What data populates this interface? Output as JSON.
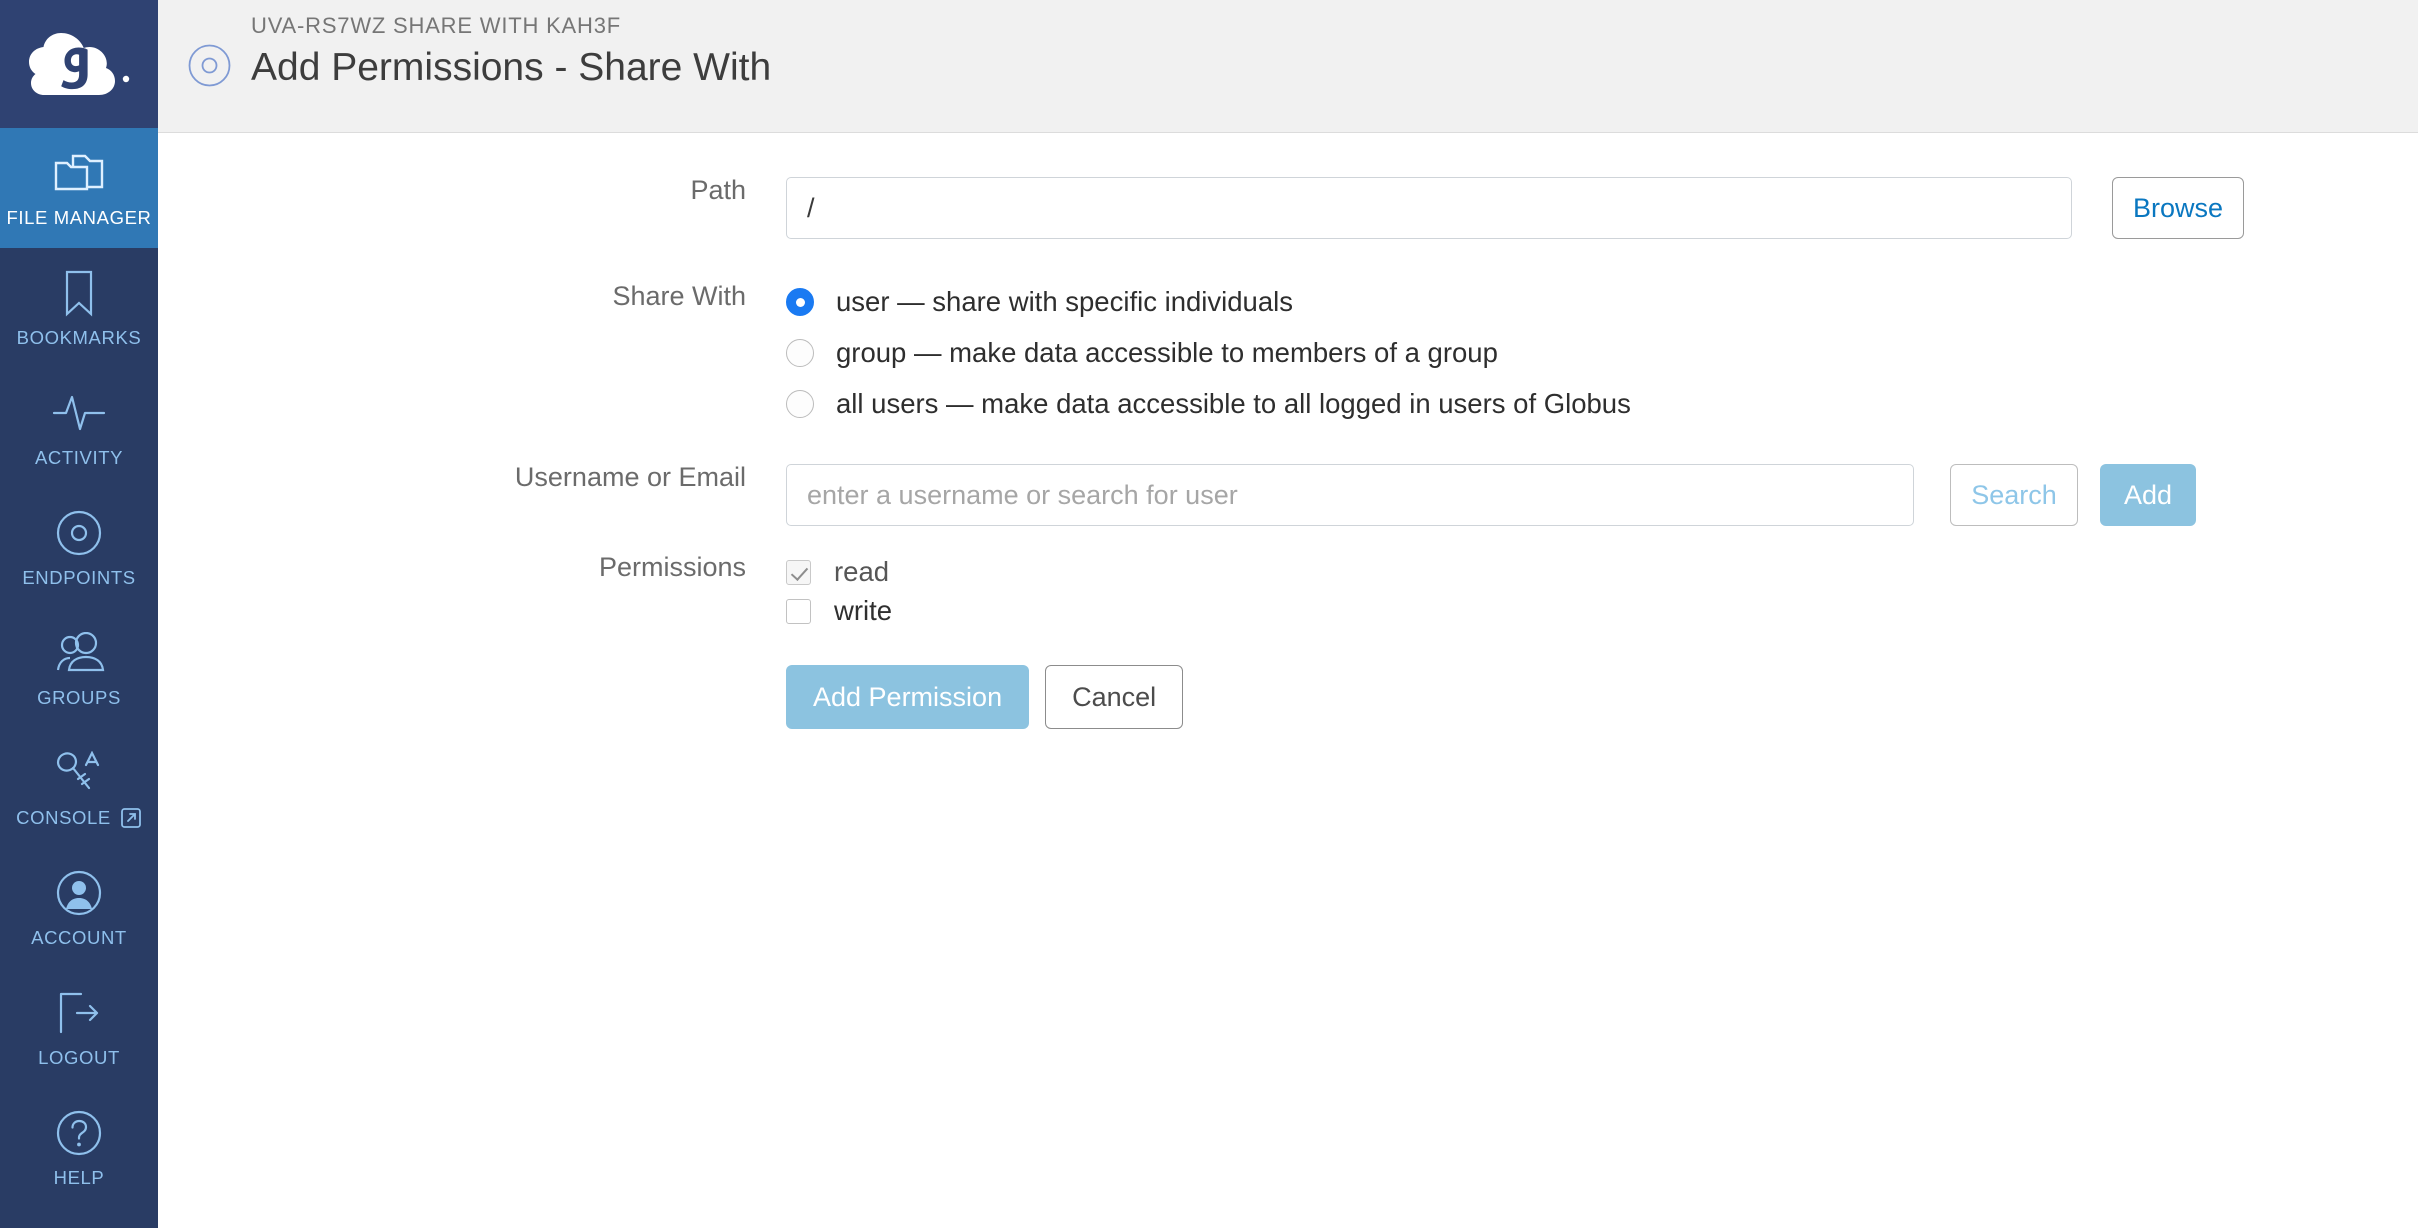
{
  "sidebar": {
    "logo_name": "globus-logo",
    "items": [
      {
        "label": "FILE MANAGER",
        "icon": "folders-icon",
        "active": true
      },
      {
        "label": "BOOKMARKS",
        "icon": "bookmark-icon",
        "active": false
      },
      {
        "label": "ACTIVITY",
        "icon": "activity-pulse-icon",
        "active": false
      },
      {
        "label": "ENDPOINTS",
        "icon": "endpoint-disc-icon",
        "active": false
      },
      {
        "label": "GROUPS",
        "icon": "groups-people-icon",
        "active": false
      },
      {
        "label": "CONSOLE",
        "icon": "key-a-icon",
        "active": false,
        "external": true
      },
      {
        "label": "ACCOUNT",
        "icon": "account-avatar-icon",
        "active": false
      },
      {
        "label": "LOGOUT",
        "icon": "logout-arrow-icon",
        "active": false
      },
      {
        "label": "HELP",
        "icon": "question-circle-icon",
        "active": false
      }
    ]
  },
  "header": {
    "icon": "endpoint-disc-icon",
    "breadcrumb": "UVA-RS7WZ SHARE WITH KAH3F",
    "title": "Add Permissions - Share With"
  },
  "form": {
    "path": {
      "label": "Path",
      "value": "/",
      "browse_label": "Browse"
    },
    "share_with": {
      "label": "Share With",
      "selected": "user",
      "options": [
        {
          "id": "user",
          "label": "user — share with specific individuals"
        },
        {
          "id": "group",
          "label": "group — make data accessible to members of a group"
        },
        {
          "id": "all-users",
          "label": "all users — make data accessible to all logged in users of Globus"
        }
      ]
    },
    "username": {
      "label": "Username or Email",
      "value": "",
      "placeholder": "enter a username or search for user",
      "search_label": "Search",
      "add_label": "Add"
    },
    "permissions": {
      "label": "Permissions",
      "options": [
        {
          "id": "read",
          "label": "read",
          "checked": true,
          "disabled": true
        },
        {
          "id": "write",
          "label": "write",
          "checked": false,
          "disabled": false
        }
      ]
    },
    "actions": {
      "submit_label": "Add Permission",
      "cancel_label": "Cancel"
    }
  },
  "colors": {
    "sidebar_bg": "#293c64",
    "sidebar_logo_bg": "#2f4272",
    "sidebar_active": "#3078b5",
    "sidebar_text": "#8fc0ec",
    "header_bg": "#f1f1f1",
    "link_blue": "#0a77c0",
    "accent_light_blue": "#8cc3e0",
    "radio_selected": "#1a7af2"
  }
}
